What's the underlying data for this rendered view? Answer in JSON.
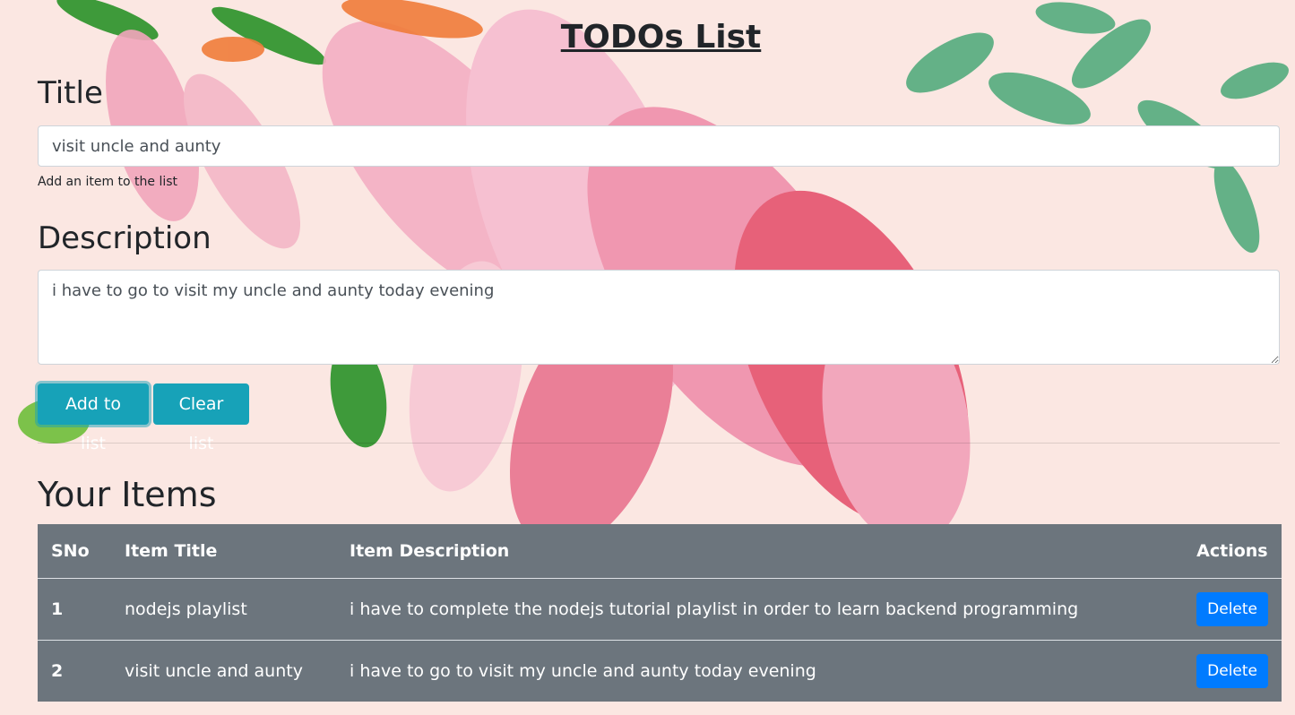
{
  "app": {
    "title": "TODOs List"
  },
  "form": {
    "title_label": "Title",
    "title_value": "visit uncle and aunty",
    "title_help": "Add an item to the list",
    "description_label": "Description",
    "description_value": "i have to go to visit my uncle and aunty today evening",
    "add_button": "Add to list",
    "clear_button": "Clear list"
  },
  "items": {
    "heading": "Your Items",
    "columns": [
      "SNo",
      "Item Title",
      "Item Description",
      "Actions"
    ],
    "rows": [
      {
        "sno": "1",
        "title": "nodejs playlist",
        "description": "i have to complete the nodejs tutorial playlist in order to learn backend programming",
        "action": "Delete"
      },
      {
        "sno": "2",
        "title": "visit uncle and aunty",
        "description": "i have to go to visit my uncle and aunty today evening",
        "action": "Delete"
      }
    ]
  },
  "colors": {
    "primary_button": "#17a2b8",
    "delete_button": "#007bff",
    "table_bg": "#6c757d"
  }
}
